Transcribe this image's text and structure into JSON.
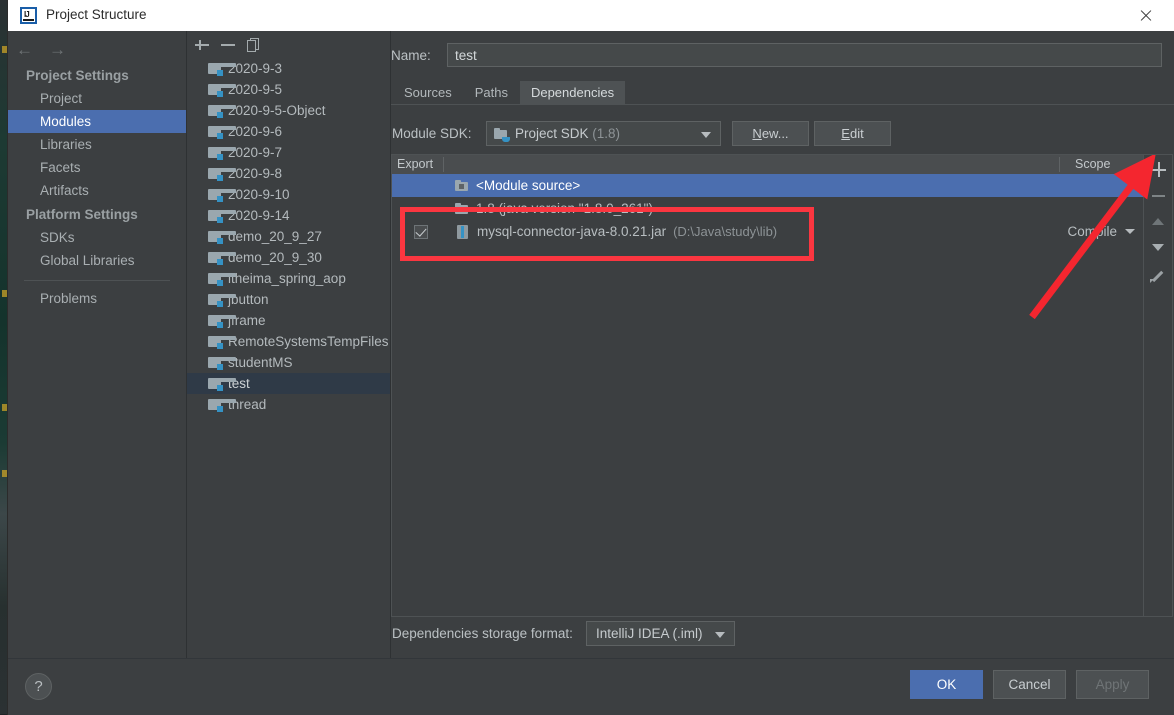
{
  "window": {
    "title": "Project Structure",
    "app_icon": "intellij-idea-icon",
    "close_icon": "close-icon"
  },
  "sidebar": {
    "back_icon": "arrow-left-icon",
    "forward_icon": "arrow-right-icon",
    "groups": [
      {
        "label": "Project Settings",
        "items": [
          {
            "label": "Project",
            "selected": false
          },
          {
            "label": "Modules",
            "selected": true
          },
          {
            "label": "Libraries",
            "selected": false
          },
          {
            "label": "Facets",
            "selected": false
          },
          {
            "label": "Artifacts",
            "selected": false
          }
        ]
      },
      {
        "label": "Platform Settings",
        "items": [
          {
            "label": "SDKs",
            "selected": false
          },
          {
            "label": "Global Libraries",
            "selected": false
          }
        ]
      }
    ],
    "problems_label": "Problems"
  },
  "module_list": {
    "toolbar": {
      "add_icon": "plus-icon",
      "remove_icon": "minus-icon",
      "copy_icon": "copy-icon"
    },
    "modules": [
      {
        "name": "2020-9-3",
        "selected": false
      },
      {
        "name": "2020-9-5",
        "selected": false
      },
      {
        "name": "2020-9-5-Object",
        "selected": false
      },
      {
        "name": "2020-9-6",
        "selected": false
      },
      {
        "name": "2020-9-7",
        "selected": false
      },
      {
        "name": "2020-9-8",
        "selected": false
      },
      {
        "name": "2020-9-10",
        "selected": false
      },
      {
        "name": "2020-9-14",
        "selected": false
      },
      {
        "name": "demo_20_9_27",
        "selected": false
      },
      {
        "name": "demo_20_9_30",
        "selected": false
      },
      {
        "name": "itheima_spring_aop",
        "selected": false
      },
      {
        "name": "jbutton",
        "selected": false
      },
      {
        "name": "jframe",
        "selected": false
      },
      {
        "name": "RemoteSystemsTempFiles",
        "selected": false
      },
      {
        "name": "studentMS",
        "selected": false
      },
      {
        "name": "test",
        "selected": true
      },
      {
        "name": "thread",
        "selected": false
      }
    ]
  },
  "detail": {
    "name_label": "Name:",
    "name_value": "test",
    "tabs": [
      {
        "label": "Sources",
        "active": false
      },
      {
        "label": "Paths",
        "active": false
      },
      {
        "label": "Dependencies",
        "active": true
      }
    ],
    "sdk_label": "Module SDK:",
    "sdk_value": "Project SDK",
    "sdk_version": "(1.8)",
    "sdk_icon": "module-sdk-icon",
    "sdk_dropdown_icon": "chevron-down-icon",
    "new_button": "New...",
    "edit_button": "Edit",
    "table": {
      "columns": [
        "Export",
        "",
        "Scope"
      ],
      "rows": [
        {
          "kind": "module-source",
          "checkbox": null,
          "icon": "module-source-icon",
          "label": "<Module source>",
          "path": "",
          "scope": "",
          "selected": true
        },
        {
          "kind": "sdk",
          "checkbox": null,
          "icon": "sdk-icon",
          "label": "1.8 (java version \"1.8.0_261\")",
          "path": "",
          "scope": "",
          "selected": false
        },
        {
          "kind": "jar",
          "checkbox": "checked",
          "icon": "jar-icon",
          "label": "mysql-connector-java-8.0.21.jar",
          "path": "(D:\\Java\\study\\lib)",
          "scope": "Compile",
          "selected": false
        }
      ]
    },
    "side_toolbar": {
      "add_icon": "plus-icon",
      "remove_icon": "minus-icon",
      "move_up_icon": "arrow-up-icon",
      "move_down_icon": "arrow-down-icon",
      "edit_icon": "pencil-icon"
    },
    "storage_label": "Dependencies storage format:",
    "storage_value": "IntelliJ IDEA (.iml)",
    "storage_dropdown_icon": "chevron-down-icon"
  },
  "footer": {
    "help_label": "?",
    "ok_label": "OK",
    "cancel_label": "Cancel",
    "apply_label": "Apply"
  },
  "annotations": {
    "highlight_rect_color": "#fb3640",
    "arrow_color": "#f4262f",
    "arrow_target": "add-dependency-button"
  },
  "colors": {
    "accent_blue": "#4b6eaf",
    "panel_bg": "#3c3f41",
    "titlebar_bg": "#ffffff",
    "text_primary": "#b8bec1",
    "text_muted": "#8d9396"
  }
}
